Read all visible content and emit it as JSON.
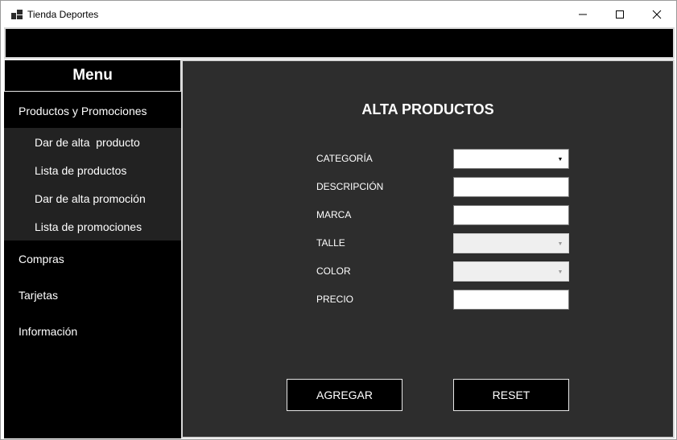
{
  "window": {
    "title": "Tienda Deportes"
  },
  "sidebar": {
    "menu_title": "Menu",
    "items": [
      {
        "label": "Productos y Promociones"
      },
      {
        "label": "Compras"
      },
      {
        "label": "Tarjetas"
      },
      {
        "label": "Información"
      }
    ],
    "subitems": [
      {
        "label": "Dar de alta  producto"
      },
      {
        "label": "Lista de productos"
      },
      {
        "label": "Dar de alta promoción"
      },
      {
        "label": "Lista de promociones"
      }
    ]
  },
  "form": {
    "title": "ALTA PRODUCTOS",
    "fields": [
      {
        "label": "CATEGORÍA",
        "value": ""
      },
      {
        "label": "DESCRIPCIÓN",
        "value": ""
      },
      {
        "label": "MARCA",
        "value": ""
      },
      {
        "label": "TALLE",
        "value": ""
      },
      {
        "label": "COLOR",
        "value": ""
      },
      {
        "label": "PRECIO",
        "value": ""
      }
    ],
    "add_button": "AGREGAR",
    "reset_button": "RESET"
  },
  "colors": {
    "sidebar_bg": "#000000",
    "submenu_bg": "#222222",
    "main_bg": "#2d2d2d",
    "text": "#ffffff"
  }
}
